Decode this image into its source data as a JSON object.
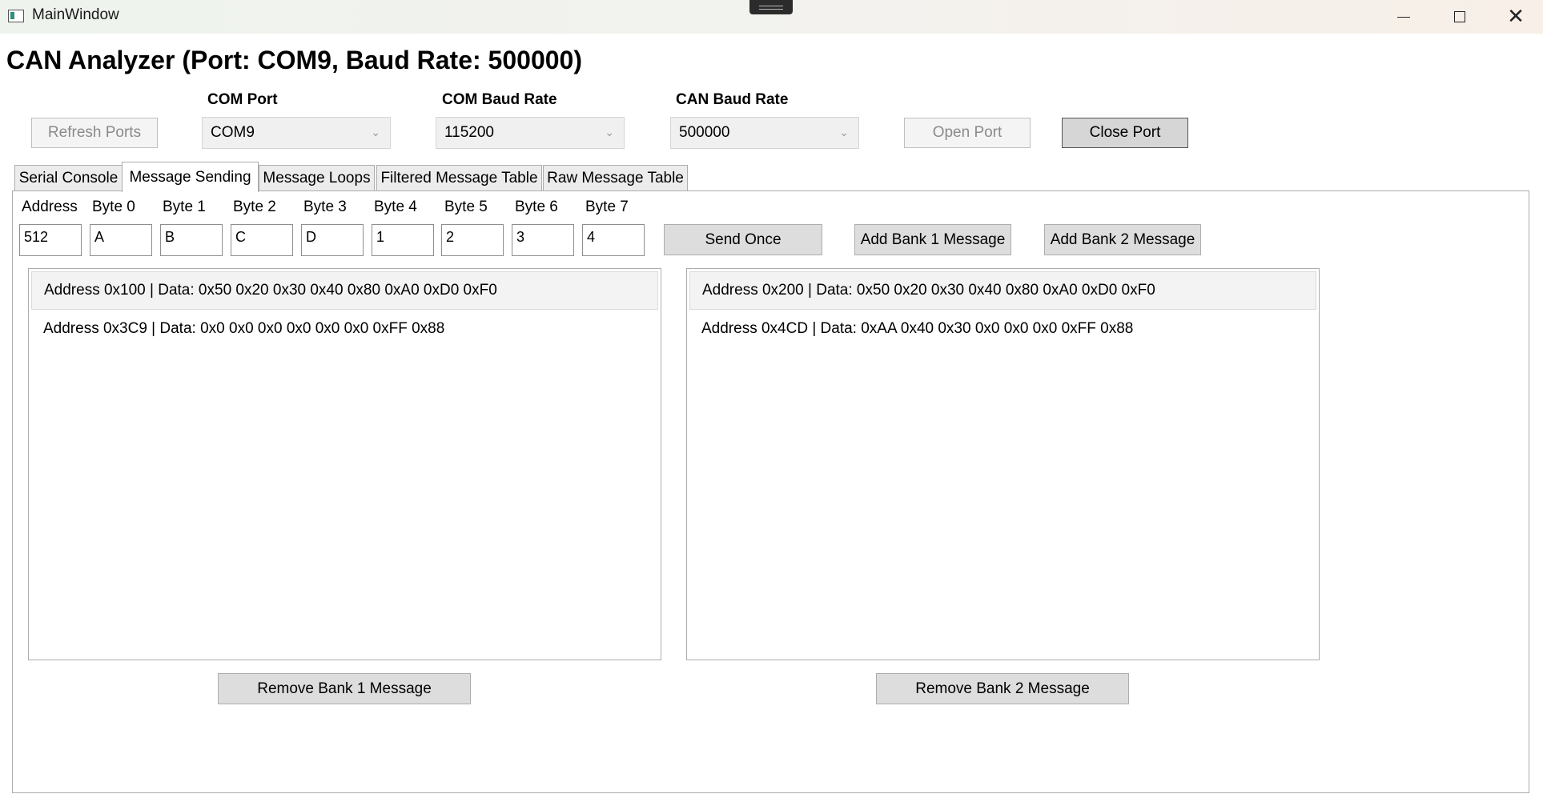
{
  "window": {
    "title": "MainWindow",
    "controls": {
      "minimize": "—",
      "maximize": "□",
      "close": "✕"
    }
  },
  "heading": "CAN Analyzer (Port: COM9, Baud Rate: 500000)",
  "toolbar": {
    "refresh_label": "Refresh Ports",
    "com_port_label": "COM Port",
    "com_port_value": "COM9",
    "com_baud_label": "COM Baud Rate",
    "com_baud_value": "115200",
    "can_baud_label": "CAN Baud Rate",
    "can_baud_value": "500000",
    "open_label": "Open Port",
    "close_label": "Close Port"
  },
  "tabs": [
    {
      "label": "Serial Console"
    },
    {
      "label": "Message Sending",
      "selected": true
    },
    {
      "label": "Message Loops"
    },
    {
      "label": "Filtered Message Table"
    },
    {
      "label": "Raw Message Table"
    }
  ],
  "sending": {
    "fields": [
      {
        "label": "Address",
        "value": "512"
      },
      {
        "label": "Byte 0",
        "value": "A"
      },
      {
        "label": "Byte 1",
        "value": "B"
      },
      {
        "label": "Byte 2",
        "value": "C"
      },
      {
        "label": "Byte 3",
        "value": "D"
      },
      {
        "label": "Byte 4",
        "value": "1"
      },
      {
        "label": "Byte 5",
        "value": "2"
      },
      {
        "label": "Byte 6",
        "value": "3"
      },
      {
        "label": "Byte 7",
        "value": "4"
      }
    ],
    "send_once_label": "Send Once",
    "add_bank1_label": "Add Bank 1 Message",
    "add_bank2_label": "Add Bank 2 Message"
  },
  "bank1": {
    "items": [
      "Address 0x100 | Data: 0x50 0x20 0x30 0x40 0x80 0xA0 0xD0 0xF0",
      "Address 0x3C9 | Data: 0x0 0x0 0x0 0x0 0x0 0x0 0xFF 0x88"
    ],
    "remove_label": "Remove Bank 1 Message"
  },
  "bank2": {
    "items": [
      "Address 0x200 | Data: 0x50 0x20 0x30 0x40 0x80 0xA0 0xD0 0xF0",
      "Address 0x4CD | Data: 0xAA 0x40 0x30 0x0 0x0 0x0 0xFF 0x88"
    ],
    "remove_label": "Remove Bank 2 Message"
  }
}
